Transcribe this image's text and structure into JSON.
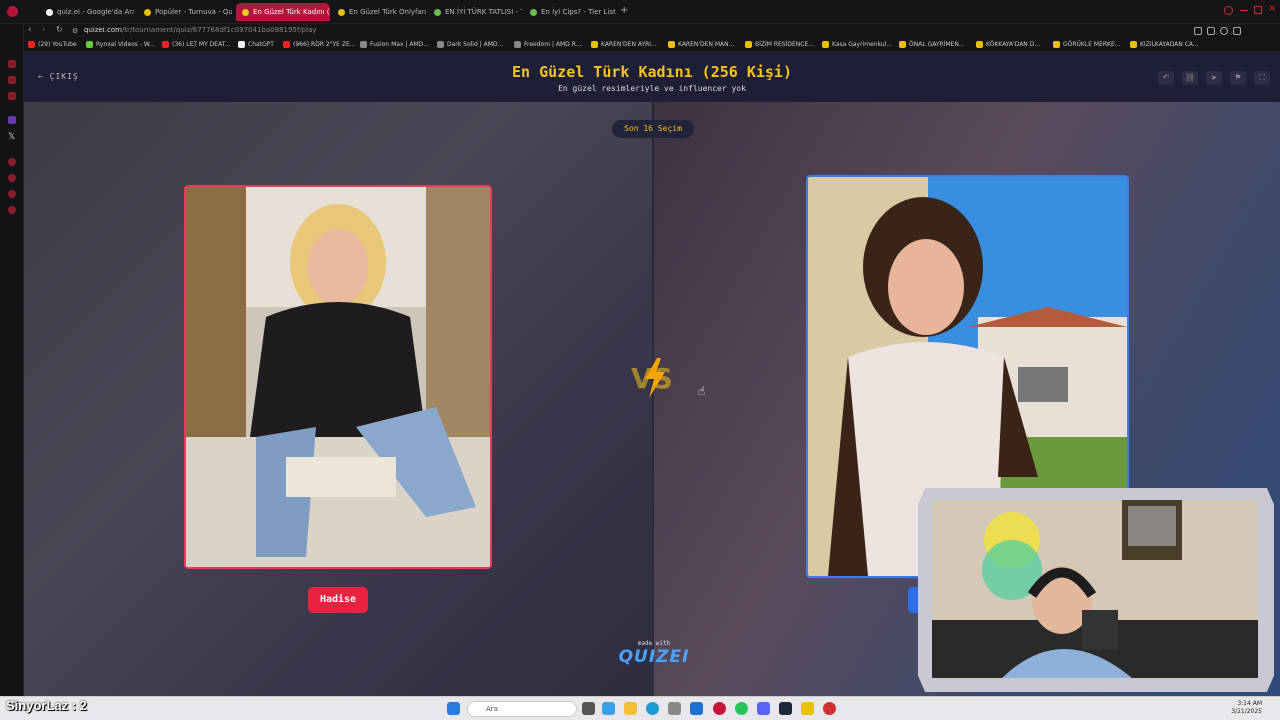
{
  "browser": {
    "tabs": [
      {
        "label": "quiz.ei - Google'da Ara",
        "active": false
      },
      {
        "label": "Popüler - Turnuva - Quizei",
        "active": false
      },
      {
        "label": "En Güzel Türk Kadını (25(",
        "active": true
      },
      {
        "label": "En Güzel Türk Onlyfansc",
        "active": false
      },
      {
        "label": "EN İYİ TÜRK TATLISI - Tie",
        "active": false
      },
      {
        "label": "En İyi Cips? - Tier List | Ki",
        "active": false
      }
    ],
    "url_domain": "quizei.com",
    "url_path": "/tr/tournament/quiz/677768df1c097041ba088195f/play",
    "bookmarks": [
      "(29) YouTube",
      "Rynxal Videos - W...",
      "(36) LET MY DEAT...",
      "ChatGPT",
      "(966) RDR 2\"YE ZE...",
      "Fusion Max | AMD...",
      "Dark Solid | AMD...",
      "Freedom | AMD R...",
      "KAREN'DEN AYRI...",
      "KAREN'DEN MAN...",
      "BİZİM RESİDENCE...",
      "Kasa Gayrimenkul...",
      "ÖNAL GAYRİMEN...",
      "KÖKKAYA'DAN D...",
      "GÖRÜKLE MERKE...",
      "KIZILKAYADAN CA..."
    ]
  },
  "quiz": {
    "exit_label": "ÇIKIŞ",
    "title": "En Güzel Türk Kadını (256 Kişi)",
    "subtitle": "En güzel resimleriyle ve influencer yok",
    "round_label": "Son 16 Seçim",
    "left_name": "Hadise",
    "vs_label": "VS",
    "made_with": "made with",
    "brand": "QUIZEI"
  },
  "taskbar": {
    "search_placeholder": "Ara",
    "time": "3:14 AM",
    "date": "3/21/2025"
  },
  "stream_overlay": "SinyorLaz : 2",
  "colors": {
    "accent_yellow": "#f5c518",
    "left_border": "#e83a5a",
    "right_border": "#3c7de8",
    "active_tab": "#b3163a"
  }
}
